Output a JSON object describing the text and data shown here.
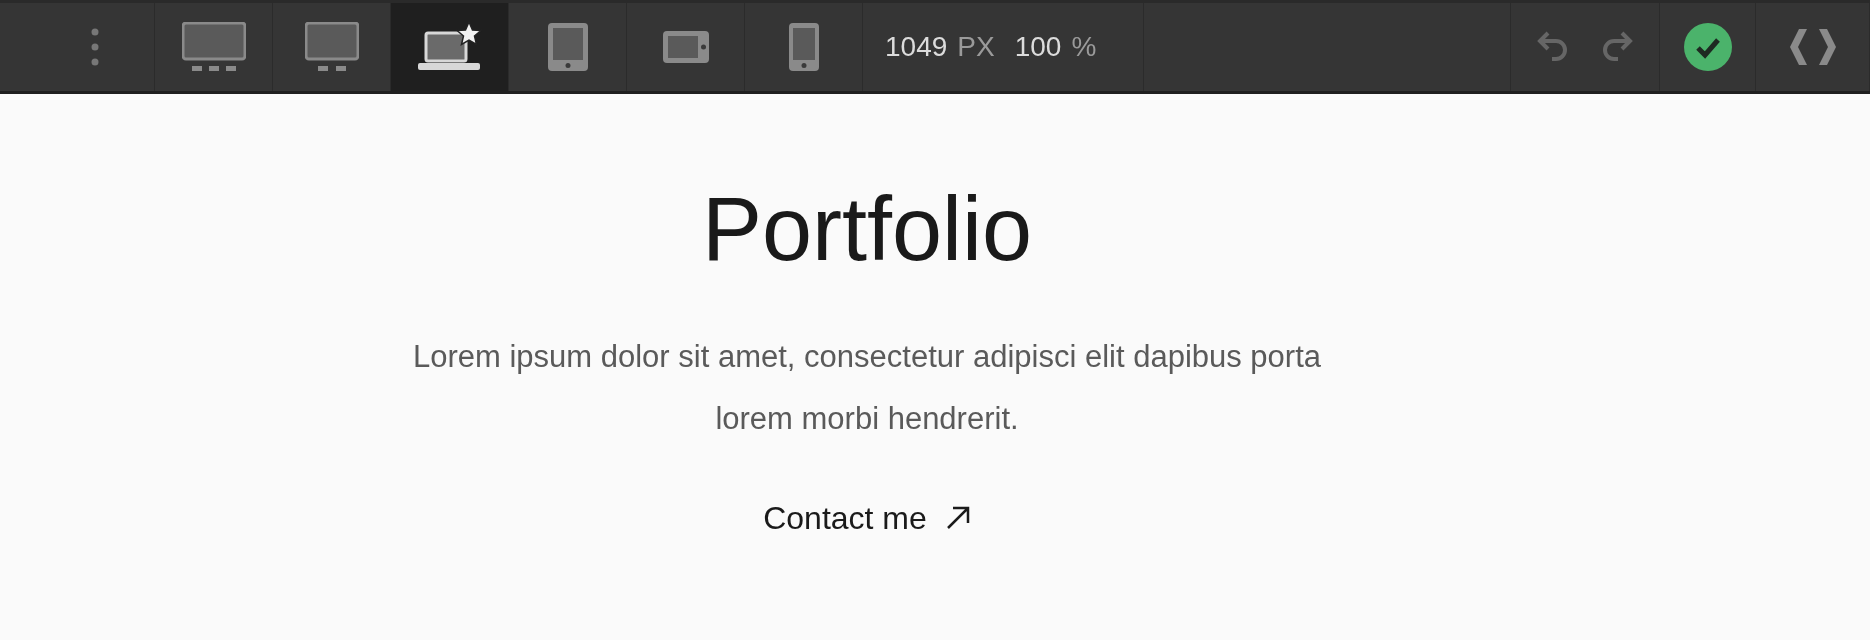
{
  "toolbar": {
    "devices": [
      {
        "kind": "desktop-large",
        "selected": false
      },
      {
        "kind": "desktop",
        "selected": false
      },
      {
        "kind": "laptop",
        "selected": true
      },
      {
        "kind": "tablet",
        "selected": false
      },
      {
        "kind": "tablet-landscape",
        "selected": false
      },
      {
        "kind": "phone",
        "selected": false
      }
    ],
    "width_value": "1049",
    "width_unit": "PX",
    "zoom_value": "100",
    "zoom_unit": "%"
  },
  "page": {
    "title": "Portfolio",
    "description": "Lorem ipsum dolor sit amet, consectetur adipisci elit dapibus porta lorem morbi hendrerit.",
    "link": "Contact me"
  }
}
